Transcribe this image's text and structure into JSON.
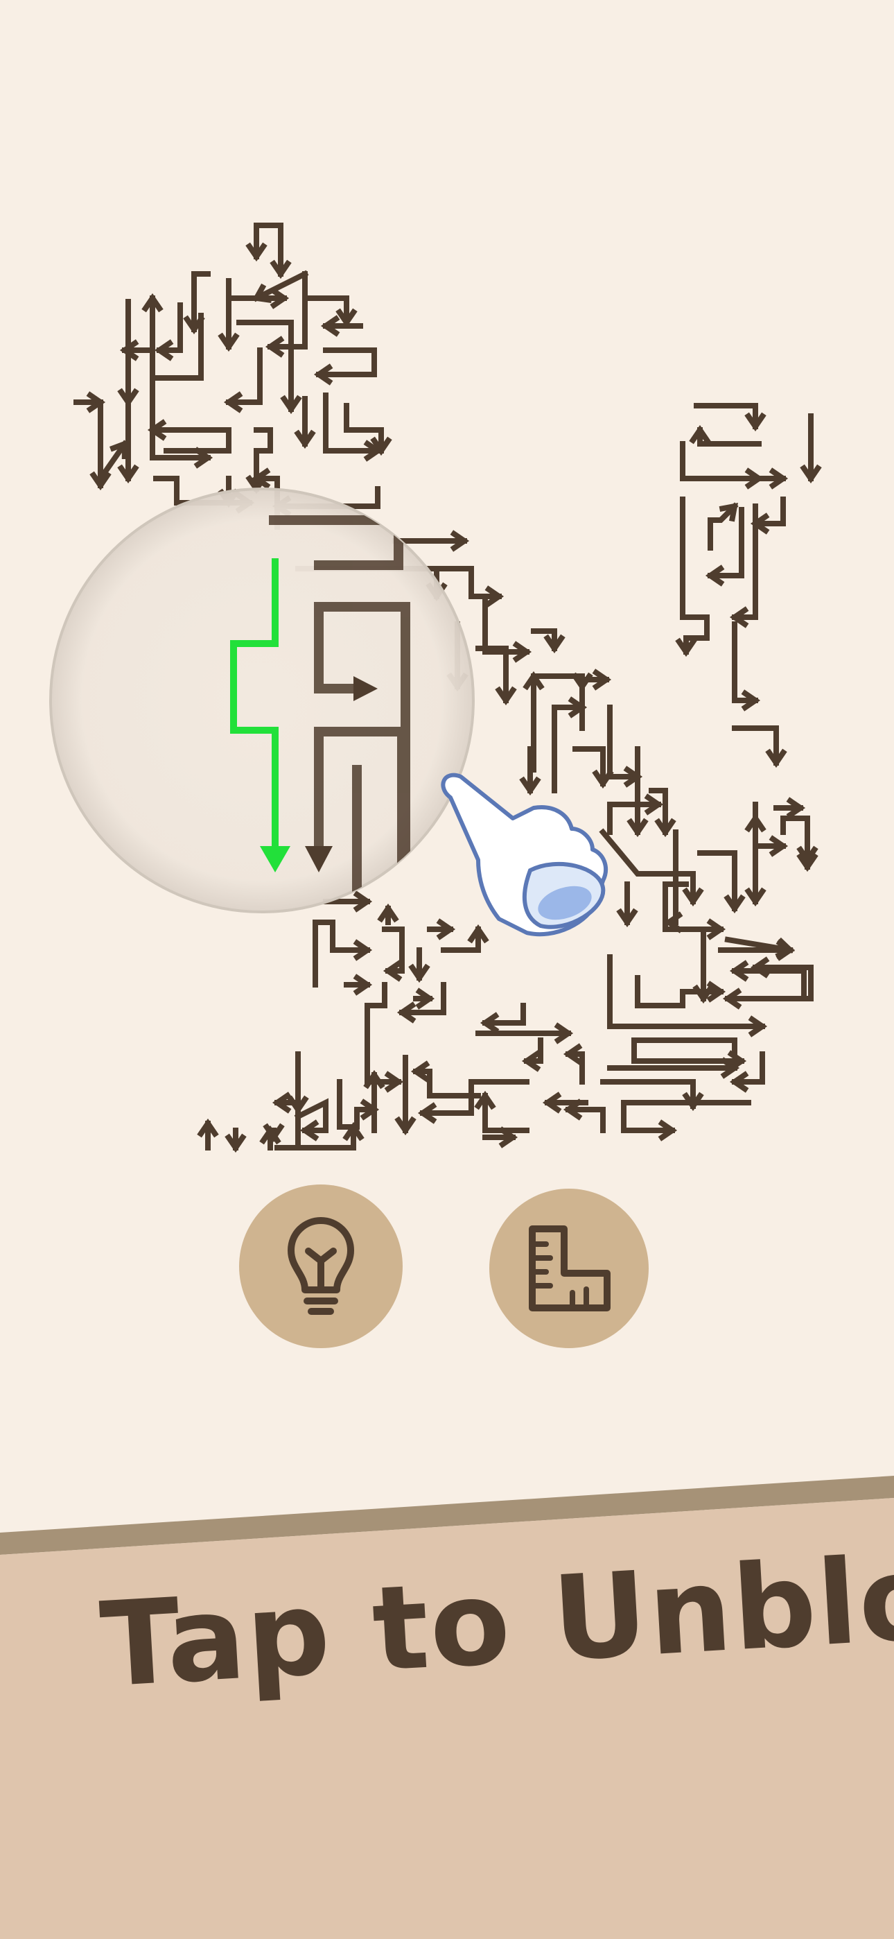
{
  "colors": {
    "background": "#f8efe5",
    "arrow": "#4f3d2e",
    "highlight_arrow": "#22e03a",
    "button_fill": "#cfb490",
    "button_icon": "#4f3d2e",
    "banner_fill": "#dfc5ad",
    "banner_stripe": "#a69277"
  },
  "tools": {
    "hint": {
      "icon": "lightbulb-icon"
    },
    "ruler": {
      "icon": "ruler-icon"
    }
  },
  "tutorial": {
    "hand_icon": "pointing-hand-icon",
    "magnifier": "magnifier-lens"
  },
  "banner": {
    "text": "Tap to Unblock!"
  }
}
